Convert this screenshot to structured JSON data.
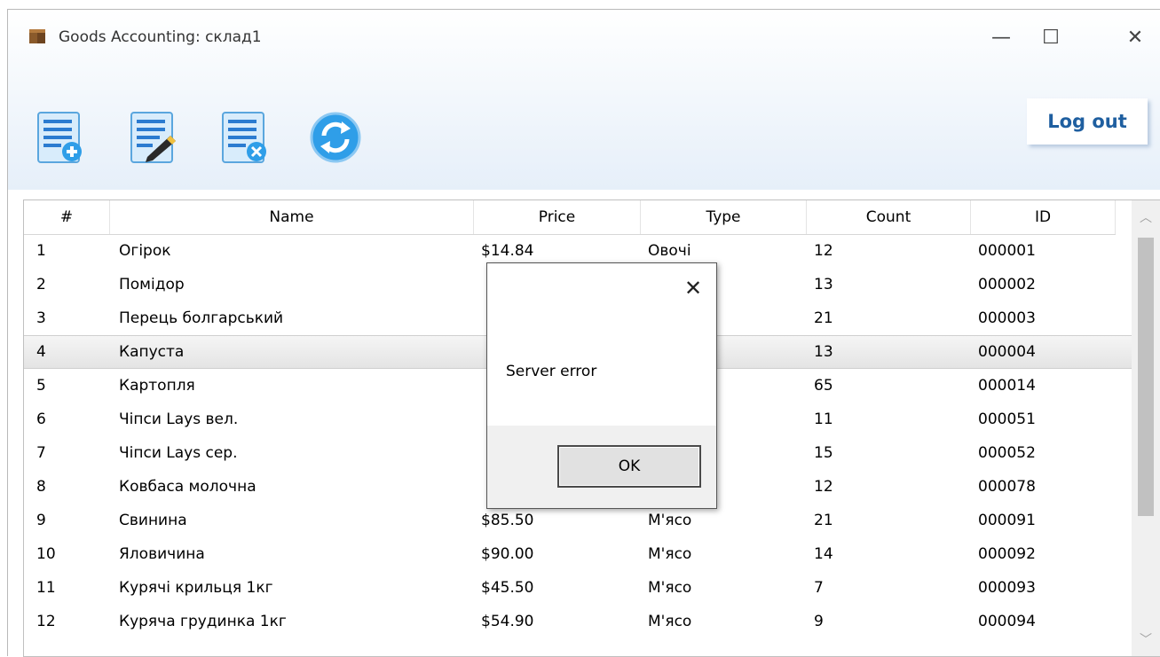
{
  "window": {
    "title": "Goods Accounting: склад1",
    "app_icon": "box-icon"
  },
  "caption": {
    "minimize": "—",
    "maximize": "☐",
    "close": "✕"
  },
  "toolbar": {
    "tools": [
      {
        "name": "add-item",
        "icon": "list-add-icon"
      },
      {
        "name": "edit-item",
        "icon": "list-edit-icon"
      },
      {
        "name": "delete-item",
        "icon": "list-delete-icon"
      },
      {
        "name": "refresh",
        "icon": "refresh-icon"
      }
    ],
    "logout_label": "Log out"
  },
  "grid": {
    "columns": [
      "#",
      "Name",
      "Price",
      "Type",
      "Count",
      "ID"
    ],
    "rows": [
      {
        "n": "1",
        "name": "Огірок",
        "price": "$14.84",
        "type": "Овочі",
        "count": "12",
        "id": "000001"
      },
      {
        "n": "2",
        "name": "Помідор",
        "price": "",
        "type": "",
        "count": "13",
        "id": "000002"
      },
      {
        "n": "3",
        "name": "Перець болгарський",
        "price": "",
        "type": "",
        "count": "21",
        "id": "000003"
      },
      {
        "n": "4",
        "name": "Капуста",
        "price": "",
        "type": "",
        "count": "13",
        "id": "000004"
      },
      {
        "n": "5",
        "name": "Картопля",
        "price": "",
        "type": "",
        "count": "65",
        "id": "000014"
      },
      {
        "n": "6",
        "name": "Чіпси Lays вел.",
        "price": "",
        "type": "",
        "count": "11",
        "id": "000051"
      },
      {
        "n": "7",
        "name": "Чіпси Lays сер.",
        "price": "",
        "type": "",
        "count": "15",
        "id": "000052"
      },
      {
        "n": "8",
        "name": "Ковбаса молочна",
        "price": "",
        "type": "",
        "count": "12",
        "id": "000078"
      },
      {
        "n": "9",
        "name": "Свинина",
        "price": "$85.50",
        "type": "М'ясо",
        "count": "21",
        "id": "000091"
      },
      {
        "n": "10",
        "name": "Яловичина",
        "price": "$90.00",
        "type": "М'ясо",
        "count": "14",
        "id": "000092"
      },
      {
        "n": "11",
        "name": "Курячі крильця 1кг",
        "price": "$45.50",
        "type": "М'ясо",
        "count": "7",
        "id": "000093"
      },
      {
        "n": "12",
        "name": "Куряча грудинка 1кг",
        "price": "$54.90",
        "type": "М'ясо",
        "count": "9",
        "id": "000094"
      }
    ],
    "selected_row": 3
  },
  "dialog": {
    "message": "Server error",
    "ok_label": "OK",
    "close": "✕"
  },
  "colors": {
    "accent": "#1f5fa0",
    "toolbar_bg": "#e6eff9",
    "selected_row": "#e4e4e4"
  }
}
